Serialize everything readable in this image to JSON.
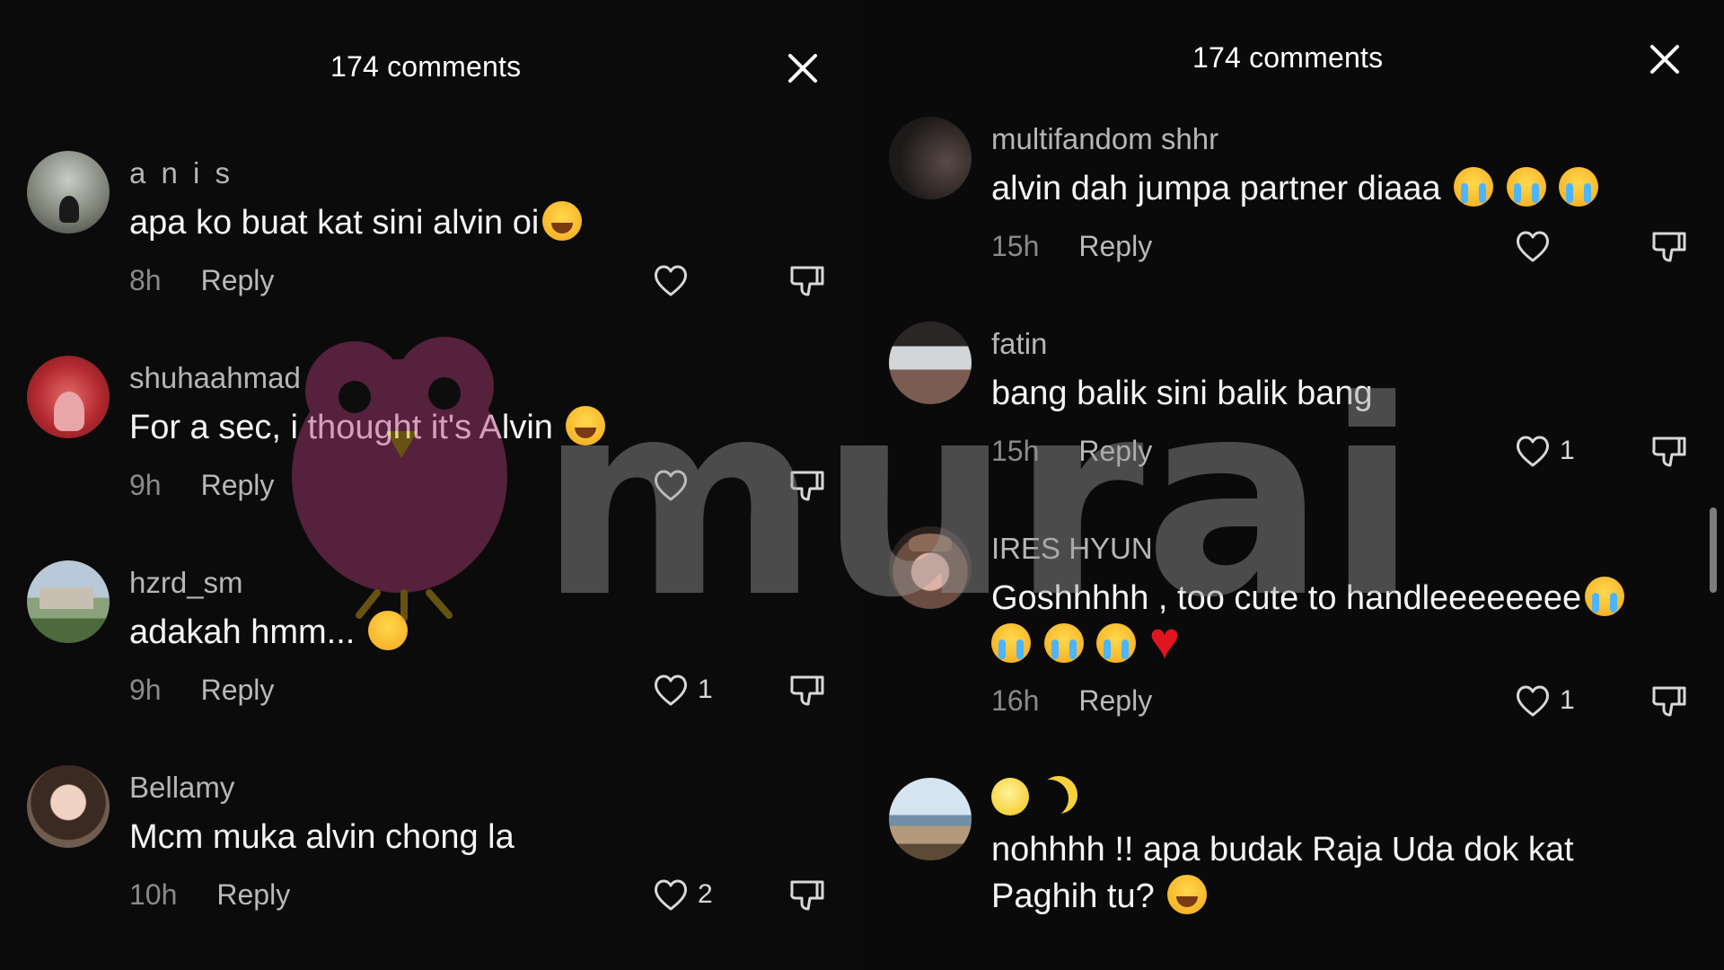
{
  "left_panel": {
    "header_title": "174 comments",
    "comments": [
      {
        "username": "a n i s",
        "text": "apa ko buat kat sini alvin oi",
        "emoji": "laugh",
        "time": "8h",
        "reply_label": "Reply",
        "likes": ""
      },
      {
        "username": "shuhaahmad",
        "text": "For a sec, i thought it's Alvin",
        "emoji": "laugh",
        "time": "9h",
        "reply_label": "Reply",
        "likes": ""
      },
      {
        "username": "hzrd_sm",
        "text": "adakah hmm...",
        "emoji": "peek",
        "time": "9h",
        "reply_label": "Reply",
        "likes": "1"
      },
      {
        "username": "Bellamy",
        "text": "Mcm muka alvin chong la",
        "time": "10h",
        "reply_label": "Reply",
        "likes": "2"
      }
    ]
  },
  "right_panel": {
    "header_title": "174 comments",
    "comments": [
      {
        "username": "multifandom shhr",
        "text": "alvin dah jumpa partner diaaa",
        "emoji": "cry x3",
        "time": "15h",
        "reply_label": "Reply",
        "likes": ""
      },
      {
        "username": "fatin",
        "text": "bang balik sini balik bang",
        "time": "15h",
        "reply_label": "Reply",
        "likes": "1"
      },
      {
        "username": "IRES HYUN",
        "text_line1": "Goshhhhh , too cute to handleeeeeeee",
        "emoji": "cry x4, red heart",
        "time": "16h",
        "reply_label": "Reply",
        "likes": "1"
      },
      {
        "username_emoji": "sun, crescent moon",
        "text_line1": "nohhhh !! apa budak Raja Uda dok kat",
        "text_line2": "Paghih tu?",
        "emoji": "laugh"
      }
    ]
  },
  "watermark": {
    "text": "murai"
  },
  "colors": {
    "background": "#000000",
    "text": "#ffffff",
    "muted": "#8a8a8a",
    "heart": "#e0141e"
  },
  "icons": [
    "close-icon",
    "heart-outline-icon",
    "dislike-icon",
    "laughing-emoji",
    "crying-emoji",
    "peeking-emoji",
    "red-heart-emoji",
    "sun-emoji",
    "moon-emoji"
  ]
}
